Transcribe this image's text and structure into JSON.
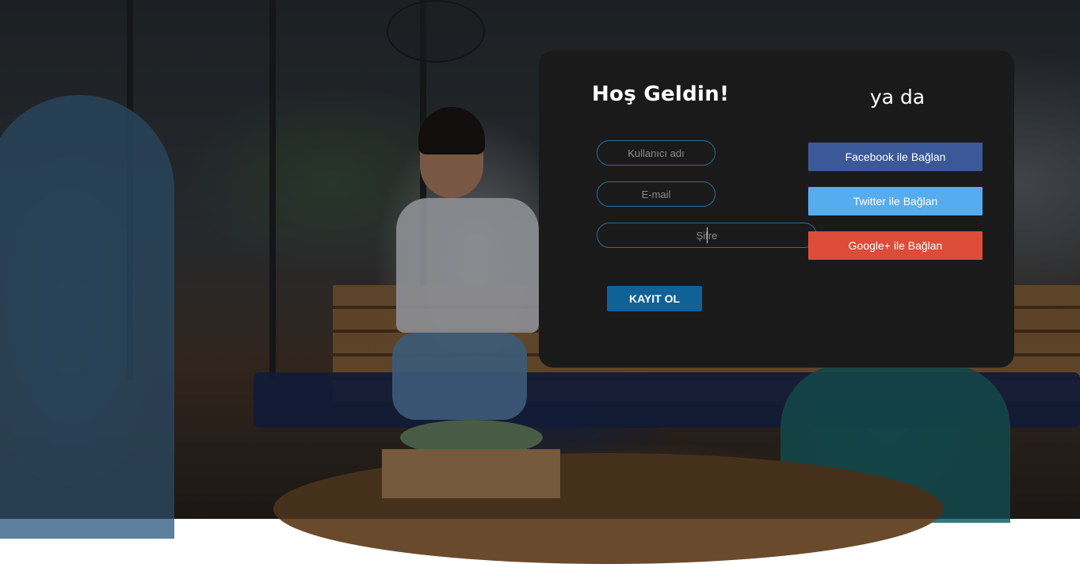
{
  "card": {
    "title": "Hoş Geldin!",
    "or_text": "ya da"
  },
  "form": {
    "username_placeholder": "Kullanıcı adı",
    "email_placeholder": "E-mail",
    "password_placeholder": "Şifre",
    "submit_label": "KAYIT OL"
  },
  "social": {
    "facebook_label": "Facebook ile Bağlan",
    "twitter_label": "Twitter ile Bağlan",
    "google_label": "Google+ ile Bağlan",
    "colors": {
      "facebook": "#3b5998",
      "twitter": "#55acee",
      "google": "#dd4b39"
    }
  },
  "colors": {
    "card_background": "#1a1a1a",
    "field_border": "#2b6f96",
    "submit_button": "#0f6196"
  }
}
